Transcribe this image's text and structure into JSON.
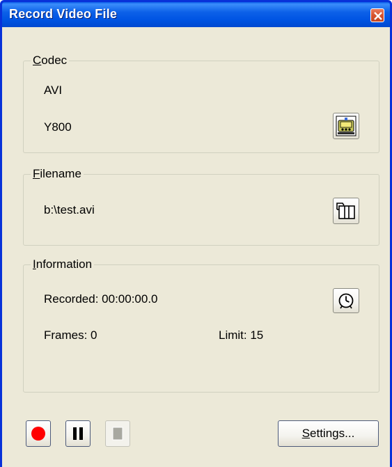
{
  "window": {
    "title": "Record Video File"
  },
  "codec": {
    "legend_access": "C",
    "legend_rest": "odec",
    "container": "AVI",
    "format": "Y800"
  },
  "filename": {
    "legend_access": "F",
    "legend_rest": "ilename",
    "value": "b:\\test.avi"
  },
  "information": {
    "legend_access": "I",
    "legend_rest": "nformation",
    "recorded": "Recorded: 00:00:00.0",
    "frames": "Frames: 0",
    "limit": "Limit: 15"
  },
  "controls": {
    "settings_access": "S",
    "settings_rest": "ettings..."
  },
  "colors": {
    "titlebar": "#0054e3",
    "dialog_bg": "#ece9d8",
    "record_red": "#ff0000",
    "close_red": "#d6532f"
  },
  "icons": {
    "close": "close-x-icon",
    "codec_properties": "codec-properties-icon",
    "browse_file": "film-folder-icon",
    "time_limit": "clock-icon",
    "record": "record-icon",
    "pause": "pause-icon",
    "stop": "stop-icon"
  }
}
